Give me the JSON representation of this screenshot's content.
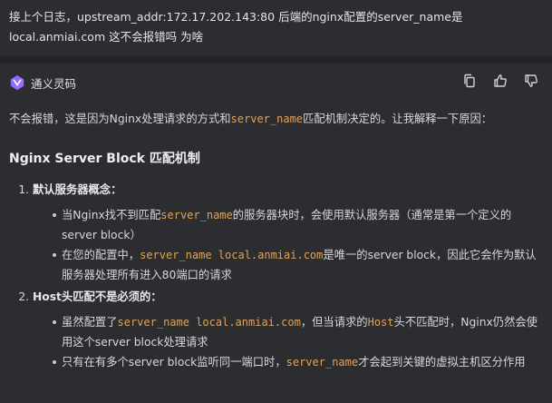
{
  "user_message": "接上个日志，upstream_addr:172.17.202.143:80 后端的nginx配置的server_name是local.anmiai.com 这不会报错吗 为啥",
  "assistant": {
    "name": "通义灵码",
    "actions": [
      {
        "name": "copy-icon"
      },
      {
        "name": "thumbs-up-icon"
      },
      {
        "name": "thumbs-down-icon"
      }
    ],
    "intro": {
      "pre": "不会报错，这是因为Nginx处理请求的方式和",
      "code": "server_name",
      "post": "匹配机制决定的。让我解释一下原因："
    },
    "heading": "Nginx Server Block 匹配机制",
    "sections": [
      {
        "title": "默认服务器概念：",
        "bullets": [
          {
            "pre": "当Nginx找不到匹配",
            "code": "server_name",
            "post": "的服务器块时，会使用默认服务器（通常是第一个定义的server block）"
          },
          {
            "pre": "在您的配置中，",
            "code": "server_name local.anmiai.com",
            "post": "是唯一的server block，因此它会作为默认服务器处理所有进入80端口的请求"
          }
        ]
      },
      {
        "title": "Host头匹配不是必须的：",
        "bullets": [
          {
            "pre": "虽然配置了",
            "code": "server_name local.anmiai.com",
            "mid": "，但当请求的",
            "code2": "Host",
            "post": "头不匹配时，Nginx仍然会使用这个server block处理请求"
          },
          {
            "pre": "只有在有多个server block监听同一端口时，",
            "code": "server_name",
            "post": "才会起到关键的虚拟主机区分作用"
          }
        ]
      }
    ]
  },
  "colors": {
    "background": "#2b2d30",
    "code": "#e0a35a",
    "text": "#d6d8dc"
  }
}
